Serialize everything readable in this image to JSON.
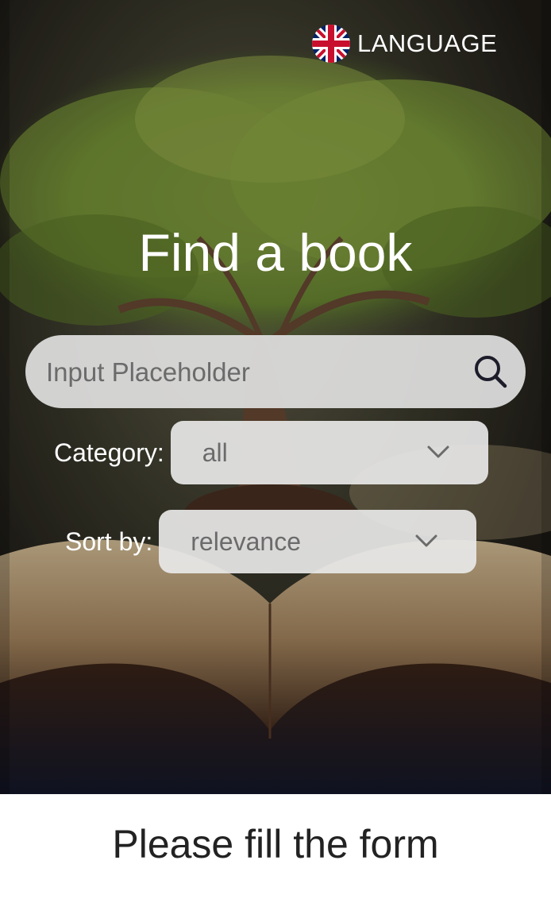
{
  "header": {
    "language_label": "LANGUAGE",
    "flag_icon": "uk-flag-icon"
  },
  "hero": {
    "title": "Find a book"
  },
  "search": {
    "placeholder": "Input Placeholder",
    "icon": "search-icon"
  },
  "filters": {
    "category": {
      "label": "Category:",
      "value": "all"
    },
    "sort": {
      "label": "Sort by:",
      "value": "relevance"
    }
  },
  "footer": {
    "message": "Please fill the form"
  },
  "colors": {
    "text_light": "#ffffff",
    "field_bg": "#e1e1e1",
    "placeholder": "#6b6b6b",
    "footer_text": "#222222"
  }
}
